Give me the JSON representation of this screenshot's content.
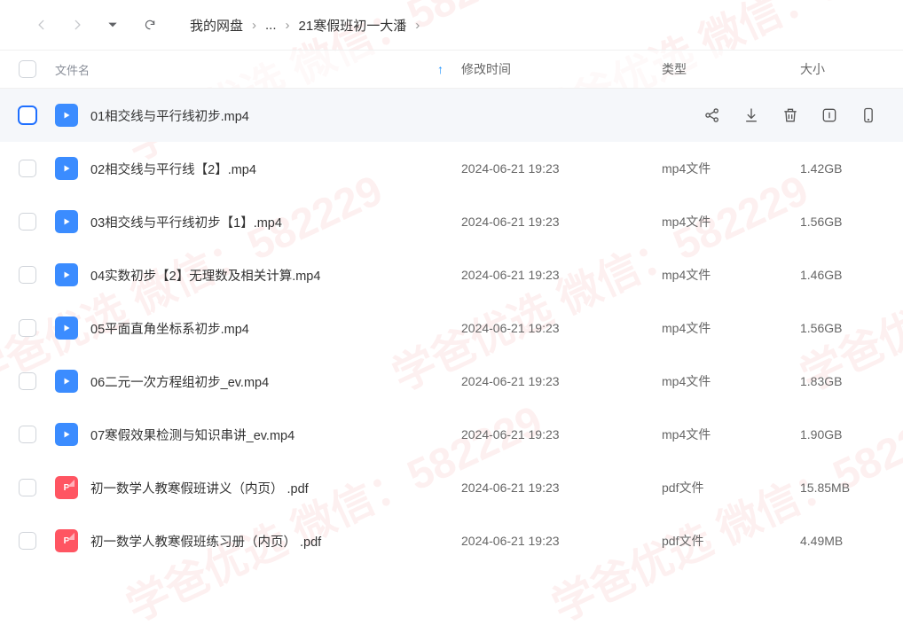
{
  "breadcrumb": {
    "root": "我的网盘",
    "mid": "...",
    "current": "21寒假班初一大潘"
  },
  "headers": {
    "name": "文件名",
    "time": "修改时间",
    "type": "类型",
    "size": "大小"
  },
  "files": [
    {
      "name": "01相交线与平行线初步.mp4",
      "time": "",
      "type": "",
      "size": "",
      "icon": "video",
      "selected": true
    },
    {
      "name": "02相交线与平行线【2】.mp4",
      "time": "2024-06-21 19:23",
      "type": "mp4文件",
      "size": "1.42GB",
      "icon": "video"
    },
    {
      "name": "03相交线与平行线初步【1】.mp4",
      "time": "2024-06-21 19:23",
      "type": "mp4文件",
      "size": "1.56GB",
      "icon": "video"
    },
    {
      "name": "04实数初步【2】无理数及相关计算.mp4",
      "time": "2024-06-21 19:23",
      "type": "mp4文件",
      "size": "1.46GB",
      "icon": "video"
    },
    {
      "name": "05平面直角坐标系初步.mp4",
      "time": "2024-06-21 19:23",
      "type": "mp4文件",
      "size": "1.56GB",
      "icon": "video"
    },
    {
      "name": "06二元一次方程组初步_ev.mp4",
      "time": "2024-06-21 19:23",
      "type": "mp4文件",
      "size": "1.83GB",
      "icon": "video"
    },
    {
      "name": "07寒假效果检测与知识串讲_ev.mp4",
      "time": "2024-06-21 19:23",
      "type": "mp4文件",
      "size": "1.90GB",
      "icon": "video"
    },
    {
      "name": "初一数学人教寒假班讲义（内页） .pdf",
      "time": "2024-06-21 19:23",
      "type": "pdf文件",
      "size": "15.85MB",
      "icon": "pdf"
    },
    {
      "name": "初一数学人教寒假班练习册（内页） .pdf",
      "time": "2024-06-21 19:23",
      "type": "pdf文件",
      "size": "4.49MB",
      "icon": "pdf"
    }
  ],
  "watermark": "学爸优选 微信：582229"
}
